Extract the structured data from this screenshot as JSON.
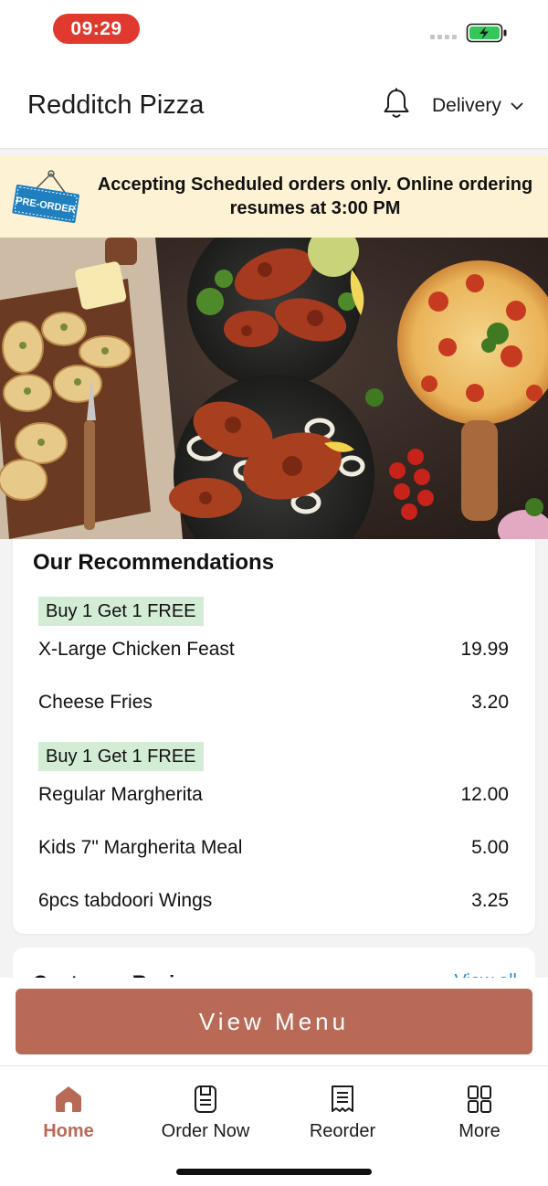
{
  "status_bar": {
    "time": "09:29"
  },
  "header": {
    "store_name": "Redditch Pizza",
    "delivery_mode": "Delivery"
  },
  "banner": {
    "badge": "PRE-ORDER",
    "message": "Accepting Scheduled orders only. Online ordering resumes at 3:00 PM"
  },
  "recommendations": {
    "title": "Our Recommendations",
    "items": [
      {
        "tag": "Buy 1 Get 1 FREE",
        "name": "X-Large Chicken Feast",
        "price": "19.99"
      },
      {
        "tag": "",
        "name": "Cheese Fries",
        "price": "3.20"
      },
      {
        "tag": "Buy 1 Get 1 FREE",
        "name": "Regular Margherita",
        "price": "12.00"
      },
      {
        "tag": "",
        "name": "Kids 7\" Margherita Meal",
        "price": "5.00"
      },
      {
        "tag": "",
        "name": "6pcs tabdoori Wings",
        "price": "3.25"
      }
    ]
  },
  "reviews": {
    "title": "Customer Reviews",
    "link": "View all"
  },
  "actions": {
    "view_menu": "View Menu"
  },
  "tabs": [
    {
      "label": "Home",
      "icon": "home-icon",
      "active": true
    },
    {
      "label": "Order Now",
      "icon": "order-icon",
      "active": false
    },
    {
      "label": "Reorder",
      "icon": "receipt-icon",
      "active": false
    },
    {
      "label": "More",
      "icon": "grid-icon",
      "active": false
    }
  ],
  "colors": {
    "accent": "#b96a56",
    "banner_bg": "#fdf3d4",
    "offer_tag_bg": "#d2ecd6",
    "time_pill": "#e03a2f",
    "battery": "#34c759"
  }
}
